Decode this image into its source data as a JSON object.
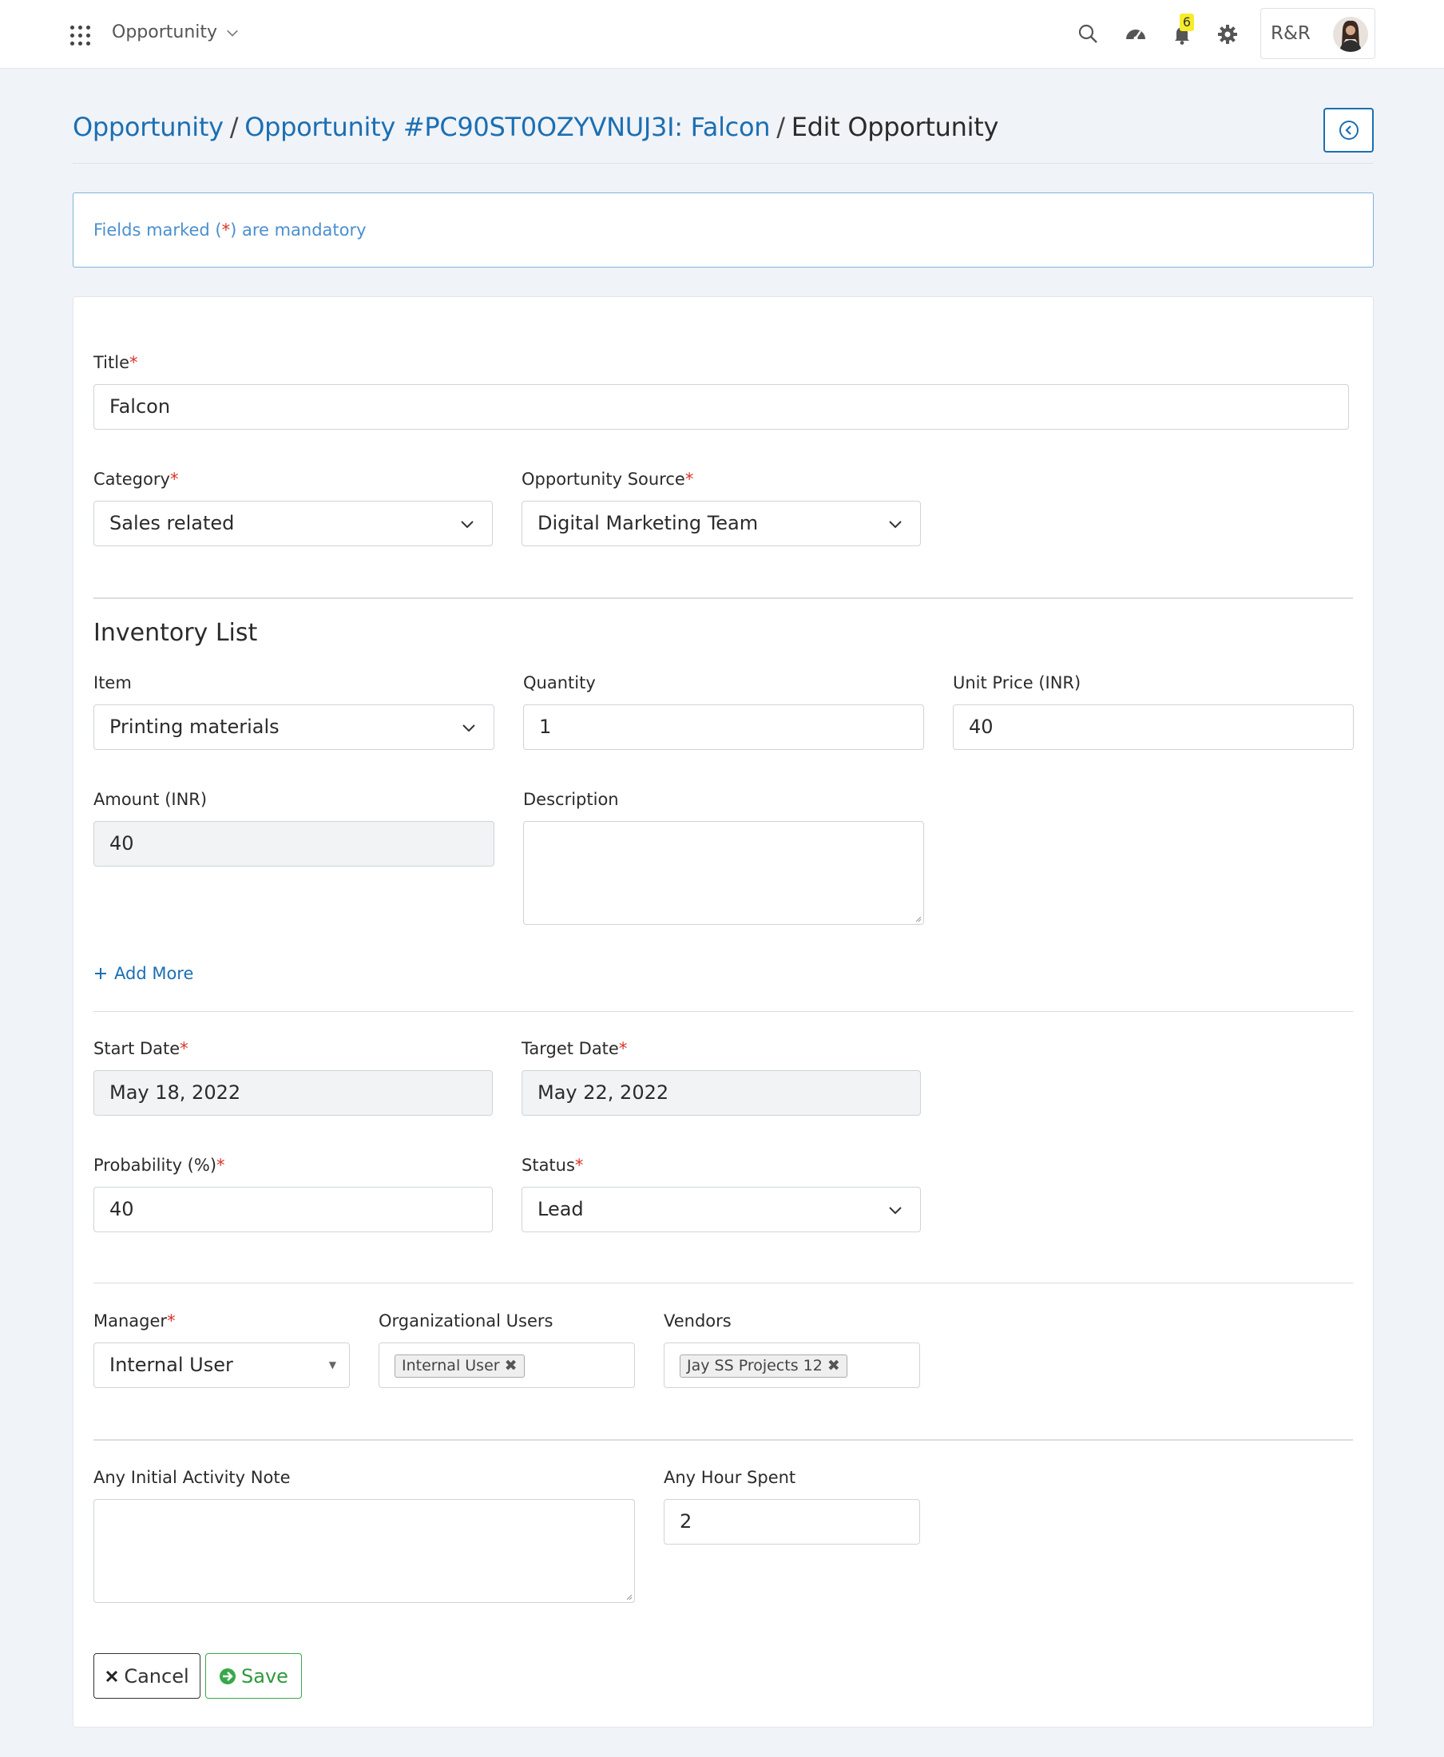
{
  "topbar": {
    "module": "Opportunity",
    "notification_count": "6",
    "company": "R&R",
    "icons": [
      "apps-grid-icon",
      "search-icon",
      "dashboard-gauge-icon",
      "bell-icon",
      "gear-icon"
    ]
  },
  "breadcrumb": {
    "root": "Opportunity",
    "sep1": "/",
    "record": "Opportunity #PC90ST0OZYVNUJ3I: Falcon",
    "sep2": "/",
    "current": "Edit Opportunity"
  },
  "notice": {
    "prefix": "Fields marked (",
    "asterisk": "*",
    "suffix": ") are mandatory"
  },
  "form": {
    "title": {
      "label": "Title",
      "value": "Falcon"
    },
    "category": {
      "label": "Category",
      "value": "Sales related"
    },
    "source": {
      "label": "Opportunity Source",
      "value": "Digital Marketing Team"
    },
    "inventory": {
      "heading": "Inventory List",
      "item_label": "Item",
      "item_value": "Printing materials",
      "quantity_label": "Quantity",
      "quantity_value": "1",
      "unit_price_label": "Unit Price (INR)",
      "unit_price_value": "40",
      "amount_label": "Amount (INR)",
      "amount_value": "40",
      "description_label": "Description",
      "description_value": "",
      "add_more": "Add More"
    },
    "start_date": {
      "label": "Start Date",
      "value": "May 18, 2022"
    },
    "target_date": {
      "label": "Target Date",
      "value": "May 22, 2022"
    },
    "probability": {
      "label": "Probability (%)",
      "value": "40"
    },
    "status": {
      "label": "Status",
      "value": "Lead"
    },
    "manager": {
      "label": "Manager",
      "value": "Internal User"
    },
    "org_users": {
      "label": "Organizational Users",
      "tags": [
        "Internal User"
      ]
    },
    "vendors": {
      "label": "Vendors",
      "tags": [
        "Jay SS Projects 12"
      ]
    },
    "activity_note": {
      "label": "Any Initial Activity Note",
      "value": ""
    },
    "hours": {
      "label": "Any Hour Spent",
      "value": "2"
    },
    "required_mark": "*",
    "remove_mark": "✖"
  },
  "actions": {
    "cancel": "Cancel",
    "save": "Save"
  },
  "colors": {
    "link": "#1b6fb3",
    "required": "#d9342b",
    "save": "#2e9a3c",
    "badge": "#f7ec2a"
  }
}
